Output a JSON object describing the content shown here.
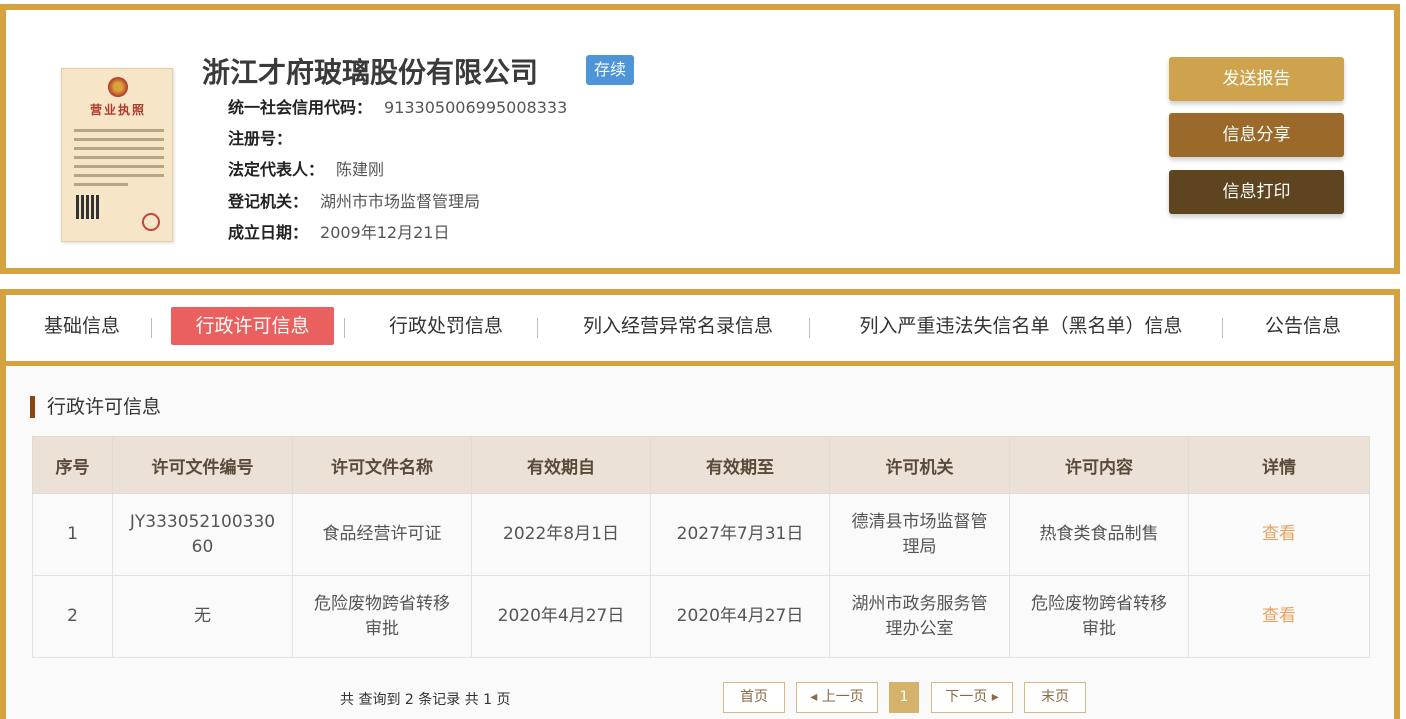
{
  "company": {
    "name": "浙江才府玻璃股份有限公司",
    "status": "存续",
    "license_image_title": "营业执照",
    "fields": [
      {
        "label": "统一社会信用代码：",
        "value": "913305006995008333"
      },
      {
        "label": "注册号：",
        "value": ""
      },
      {
        "label": "法定代表人：",
        "value": "陈建刚"
      },
      {
        "label": "登记机关：",
        "value": "湖州市市场监督管理局"
      },
      {
        "label": "成立日期：",
        "value": "2009年12月21日"
      }
    ]
  },
  "actions": {
    "send_report": "发送报告",
    "share_info": "信息分享",
    "print_info": "信息打印"
  },
  "tabs": [
    {
      "label": "基础信息",
      "active": false
    },
    {
      "label": "行政许可信息",
      "active": true
    },
    {
      "label": "行政处罚信息",
      "active": false
    },
    {
      "label": "列入经营异常名录信息",
      "active": false
    },
    {
      "label": "列入严重违法失信名单（黑名单）信息",
      "active": false
    },
    {
      "label": "公告信息",
      "active": false
    }
  ],
  "section": {
    "title": "行政许可信息"
  },
  "table": {
    "columns": [
      "序号",
      "许可文件编号",
      "许可文件名称",
      "有效期自",
      "有效期至",
      "许可机关",
      "许可内容",
      "详情"
    ],
    "rows": [
      [
        "1",
        "JY33305210033060",
        "食品经营许可证",
        "2022年8月1日",
        "2027年7月31日",
        "德清县市场监督管理局",
        "热食类食品制售",
        "查看"
      ],
      [
        "2",
        "无",
        "危险废物跨省转移审批",
        "2020年4月27日",
        "2020年4月27日",
        "湖州市政务服务管理办公室",
        "危险废物跨省转移审批",
        "查看"
      ]
    ]
  },
  "pagination": {
    "summary": "共 查询到 2 条记录 共 1 页",
    "first": "首页",
    "prev": "上一页",
    "current": "1",
    "next": "下一页",
    "last": "末页"
  }
}
